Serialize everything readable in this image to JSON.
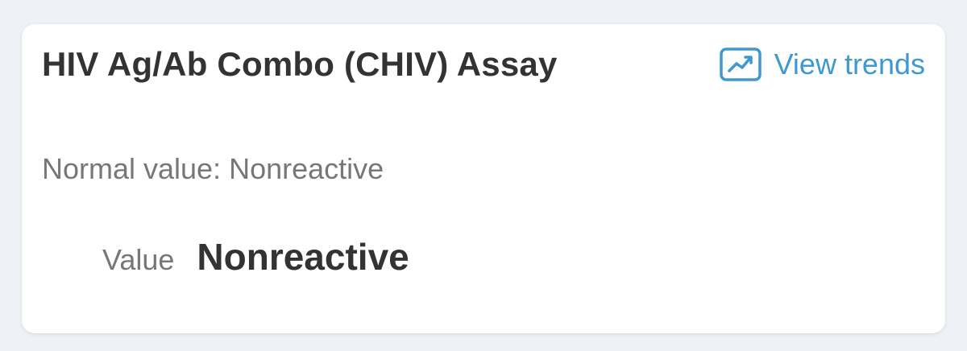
{
  "result": {
    "title": "HIV Ag/Ab Combo (CHIV) Assay",
    "normal_value_text": "Normal value: Nonreactive",
    "value_label": "Value",
    "value": "Nonreactive"
  },
  "actions": {
    "view_trends_label": "View trends",
    "view_trends_icon": "trend-chart-icon"
  },
  "colors": {
    "accent": "#3e98d1",
    "title_text": "#333333",
    "secondary_text": "#777777",
    "background": "#eef1f6",
    "card": "#ffffff"
  }
}
